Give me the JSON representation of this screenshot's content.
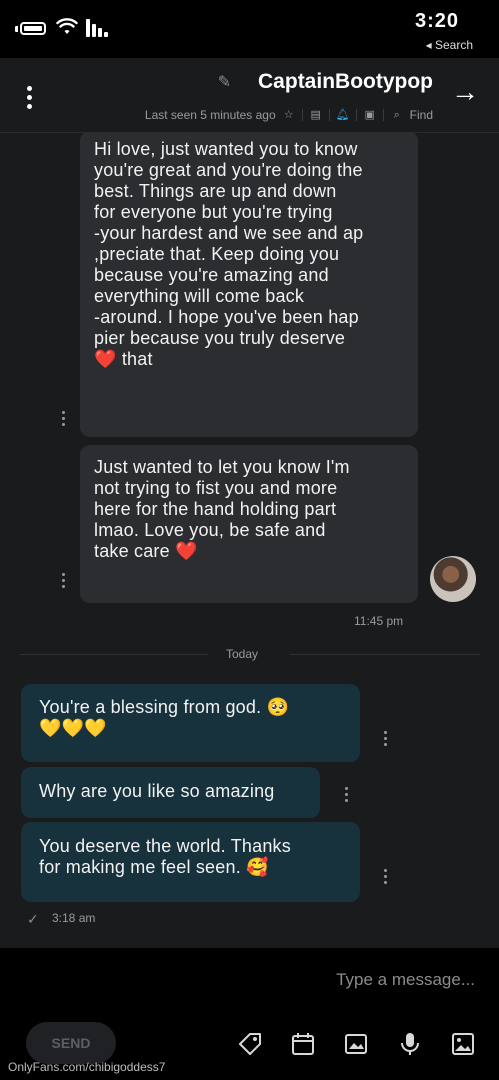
{
  "status_bar": {
    "time": "3:20",
    "back_label": "◂ Search"
  },
  "header": {
    "name": "CaptainBootypop",
    "last_seen": "Last seen 5 minutes ago",
    "find_label": "Find"
  },
  "messages": [
    {
      "direction": "incoming",
      "text": "Hi love, just wanted you to know\nyou're great and you're doing the\nbest. Things are up and down\nfor everyone but you're trying\nyour hardest and we see and ap-\npreciate that. Keep doing you,\nbecause you're amazing and\neverything will come back\naround. I hope you've been hap-\npier because you truly deserve\nthat ❤️"
    },
    {
      "direction": "incoming",
      "text": "Just wanted to let you know I'm\nnot trying to fist you and more\nhere for the hand holding part\nlmao. Love you, be safe and\ntake care ❤️",
      "time": "11:45 pm"
    },
    {
      "direction": "outgoing",
      "text": "You're a blessing from god. 🥺\n💛💛💛"
    },
    {
      "direction": "outgoing",
      "text": "Why are you like so amazing"
    },
    {
      "direction": "outgoing",
      "text": "You deserve the world. Thanks\nfor making me feel seen. 🥰",
      "time": "3:18 am"
    }
  ],
  "divider": {
    "label": "Today"
  },
  "composer": {
    "placeholder": "Type a message...",
    "send_label": "SEND"
  },
  "toolbar_icons": [
    "image-icon",
    "microphone-icon",
    "gallery-icon",
    "calendar-icon",
    "price-tag-icon"
  ],
  "watermark": "OnlyFans.com/chibigoddess7",
  "colors": {
    "background": "#1a1b1d",
    "incoming_bubble": "#2c2d31",
    "outgoing_bubble": "#17313d",
    "accent": "#2fa8e6"
  }
}
